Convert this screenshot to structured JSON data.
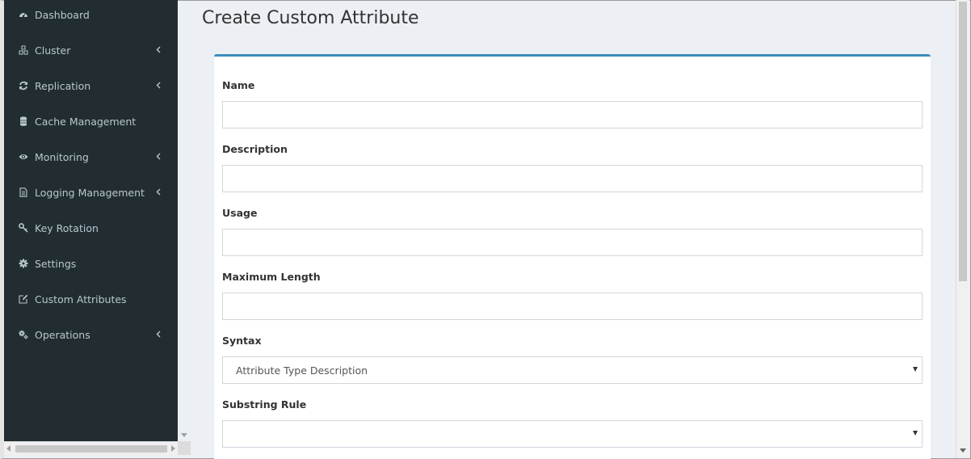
{
  "sidebar": {
    "items": [
      {
        "label": "Dashboard",
        "icon": "dashboard-icon",
        "has_submenu": false
      },
      {
        "label": "Cluster",
        "icon": "cubes-icon",
        "has_submenu": true
      },
      {
        "label": "Replication",
        "icon": "refresh-icon",
        "has_submenu": true
      },
      {
        "label": "Cache Management",
        "icon": "database-icon",
        "has_submenu": false
      },
      {
        "label": "Monitoring",
        "icon": "eye-icon",
        "has_submenu": true
      },
      {
        "label": "Logging Management",
        "icon": "file-text-icon",
        "has_submenu": true
      },
      {
        "label": "Key Rotation",
        "icon": "key-icon",
        "has_submenu": false
      },
      {
        "label": "Settings",
        "icon": "gear-icon",
        "has_submenu": false
      },
      {
        "label": "Custom Attributes",
        "icon": "edit-icon",
        "has_submenu": false
      },
      {
        "label": "Operations",
        "icon": "gears-icon",
        "has_submenu": true
      }
    ]
  },
  "page": {
    "title": "Create Custom Attribute"
  },
  "form": {
    "name_label": "Name",
    "name_value": "",
    "description_label": "Description",
    "description_value": "",
    "usage_label": "Usage",
    "usage_value": "",
    "max_length_label": "Maximum Length",
    "max_length_value": "",
    "syntax_label": "Syntax",
    "syntax_selected": "Attribute Type Description",
    "substring_rule_label": "Substring Rule",
    "substring_rule_selected": ""
  },
  "colors": {
    "sidebar_bg": "#222d32",
    "sidebar_text": "#b8c7ce",
    "content_bg": "#ecf0f5",
    "box_accent": "#3c8dbc"
  }
}
